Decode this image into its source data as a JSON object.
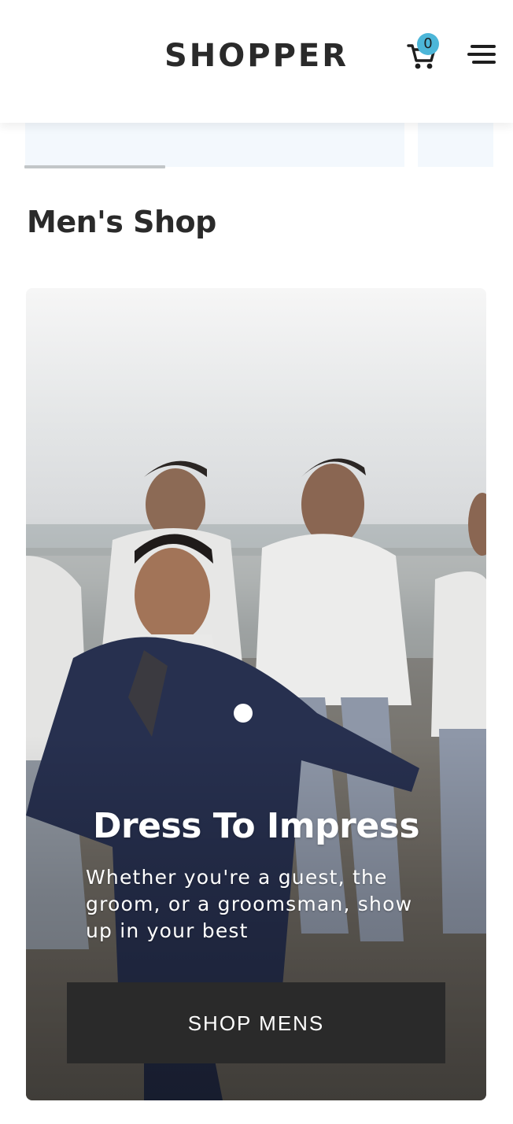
{
  "header": {
    "brand": "SHOPPER",
    "cart_count": "0",
    "cart_icon": "shopping-cart-icon",
    "menu_icon": "hamburger-menu-icon"
  },
  "carousel": {
    "slides": [
      "",
      ""
    ],
    "progress": 0.3
  },
  "section": {
    "title": "Men's Shop"
  },
  "hero": {
    "title": "Dress To Impress",
    "subtitle": "Whether you're a guest, the groom, or a groomsman, show up in your best",
    "button_label": "SHOP MENS"
  },
  "colors": {
    "badge": "#4cb6d8",
    "button_bg": "#2a2a2a",
    "brand_text": "#2a2a2a",
    "slide_bg": "#f3f8fd"
  }
}
